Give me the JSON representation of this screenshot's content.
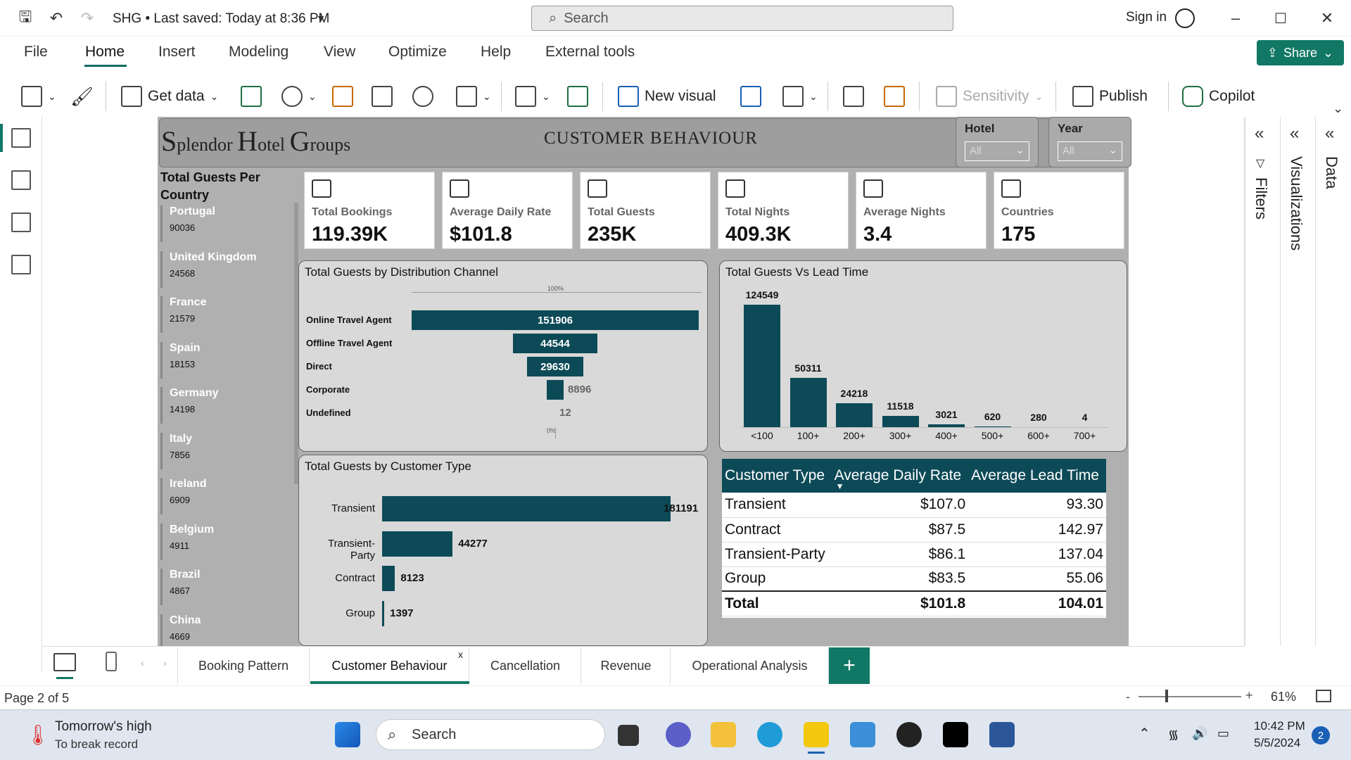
{
  "titlebar": {
    "doc_title": "SHG • Last saved: Today at 8:36 PM",
    "search_placeholder": "Search",
    "sign_in": "Sign in"
  },
  "menu": {
    "items": [
      "File",
      "Home",
      "Insert",
      "Modeling",
      "View",
      "Optimize",
      "Help",
      "External tools"
    ],
    "share": "Share"
  },
  "ribbon": {
    "get_data": "Get data",
    "new_visual": "New visual",
    "sensitivity": "Sensitivity",
    "publish": "Publish",
    "copilot": "Copilot"
  },
  "report": {
    "logo": {
      "s": "S",
      "plendor": "plendor ",
      "h": "H",
      "otel": "otel ",
      "g": "G",
      "roups": "roups"
    },
    "heading": "CUSTOMER  BEHAVIOUR",
    "slicers": [
      {
        "label": "Hotel",
        "value": "All"
      },
      {
        "label": "Year",
        "value": "All"
      }
    ],
    "country_title": "Total Guests Per Country",
    "countries": [
      {
        "name": "Portugal",
        "value": "90036"
      },
      {
        "name": "United Kingdom",
        "value": "24568"
      },
      {
        "name": "France",
        "value": "21579"
      },
      {
        "name": "Spain",
        "value": "18153"
      },
      {
        "name": "Germany",
        "value": "14198"
      },
      {
        "name": "Italy",
        "value": "7856"
      },
      {
        "name": "Ireland",
        "value": "6909"
      },
      {
        "name": "Belgium",
        "value": "4911"
      },
      {
        "name": "Brazil",
        "value": "4867"
      },
      {
        "name": "China",
        "value": "4669"
      }
    ],
    "kpis": [
      {
        "label": "Total Bookings",
        "value": "119.39K",
        "icon": "hotel-icon"
      },
      {
        "label": "Average Daily Rate",
        "value": "$101.8",
        "icon": "money-icon"
      },
      {
        "label": "Total Guests",
        "value": "235K",
        "icon": "guests-icon"
      },
      {
        "label": "Total Nights",
        "value": "409.3K",
        "icon": "bed-icon"
      },
      {
        "label": "Average Nights",
        "value": "3.4",
        "icon": "bed-icon"
      },
      {
        "label": "Countries",
        "value": "175",
        "icon": "globe-icon"
      }
    ],
    "distribution": {
      "title": "Total Guests by Distribution Channel",
      "top_pct": "100%",
      "bottom_pct": "0%",
      "rows": [
        {
          "label": "Online Travel Agent",
          "value": 151906
        },
        {
          "label": "Offline Travel Agent",
          "value": 44544
        },
        {
          "label": "Direct",
          "value": 29630
        },
        {
          "label": "Corporate",
          "value": 8896
        },
        {
          "label": "Undefined",
          "value": 12
        }
      ]
    },
    "lead_time": {
      "title": "Total Guests Vs Lead Time",
      "categories": [
        "<100",
        "100+",
        "200+",
        "300+",
        "400+",
        "500+",
        "600+",
        "700+"
      ],
      "values": [
        124549,
        50311,
        24218,
        11518,
        3021,
        620,
        280,
        4
      ]
    },
    "customer_type": {
      "title": "Total Guests by Customer Type",
      "rows": [
        {
          "label": "Transient",
          "value": 181191
        },
        {
          "label": "Transient-Party",
          "value": 44277
        },
        {
          "label": "Contract",
          "value": 8123
        },
        {
          "label": "Group",
          "value": 1397
        }
      ]
    },
    "table": {
      "headers": [
        "Customer Type",
        "Average Daily Rate",
        "Average Lead Time"
      ],
      "rows": [
        [
          "Transient",
          "$107.0",
          "93.30"
        ],
        [
          "Contract",
          "$87.5",
          "142.97"
        ],
        [
          "Transient-Party",
          "$86.1",
          "137.04"
        ],
        [
          "Group",
          "$83.5",
          "55.06"
        ]
      ],
      "total": [
        "Total",
        "$101.8",
        "104.01"
      ]
    }
  },
  "panes": {
    "filters": "Filters",
    "visualizations": "Visualizations",
    "data": "Data"
  },
  "tabs": [
    "Booking Pattern",
    "Customer Behaviour",
    "Cancellation",
    "Revenue",
    "Operational Analysis"
  ],
  "status": {
    "page": "Page 2 of 5",
    "zoom": "61%"
  },
  "taskbar": {
    "weather_title": "Tomorrow's high",
    "weather_sub": "To break record",
    "search": "Search",
    "time": "10:42 PM",
    "date": "5/5/2024",
    "notifications": "2"
  },
  "colors": {
    "accent": "#117865",
    "bar": "#0d4a57"
  },
  "chart_data": [
    {
      "type": "bar",
      "title": "Total Guests by Distribution Channel",
      "categories": [
        "Online Travel Agent",
        "Offline Travel Agent",
        "Direct",
        "Corporate",
        "Undefined"
      ],
      "values": [
        151906,
        44544,
        29630,
        8896,
        12
      ]
    },
    {
      "type": "bar",
      "title": "Total Guests Vs Lead Time",
      "categories": [
        "<100",
        "100+",
        "200+",
        "300+",
        "400+",
        "500+",
        "600+",
        "700+"
      ],
      "values": [
        124549,
        50311,
        24218,
        11518,
        3021,
        620,
        280,
        4
      ]
    },
    {
      "type": "bar",
      "title": "Total Guests by Customer Type",
      "categories": [
        "Transient",
        "Transient-Party",
        "Contract",
        "Group"
      ],
      "values": [
        181191,
        44277,
        8123,
        1397
      ]
    }
  ]
}
